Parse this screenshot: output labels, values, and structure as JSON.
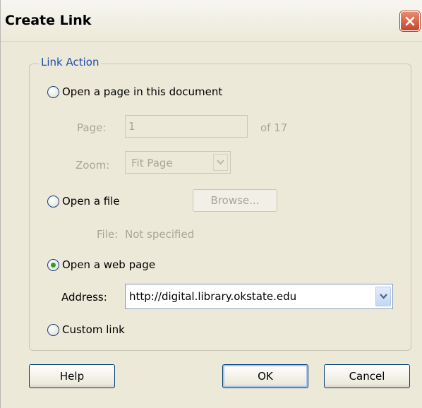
{
  "dialog": {
    "title": "Create Link",
    "close_icon": "close-icon"
  },
  "link_action": {
    "legend": "Link Action",
    "options": {
      "page_in_document": {
        "label": "Open a page in this document",
        "selected": false
      },
      "file": {
        "label": "Open a file",
        "selected": false
      },
      "web_page": {
        "label": "Open a web page",
        "selected": true
      },
      "custom": {
        "label": "Custom link",
        "selected": false
      }
    },
    "page": {
      "label": "Page:",
      "value": "1",
      "of_text": "of 17"
    },
    "zoom": {
      "label": "Zoom:",
      "value": "Fit Page"
    },
    "browse_label": "Browse...",
    "file": {
      "label": "File:",
      "value": "Not specified"
    },
    "address": {
      "label": "Address:",
      "value": "http://digital.library.okstate.edu"
    }
  },
  "buttons": {
    "help": "Help",
    "ok": "OK",
    "cancel": "Cancel"
  },
  "colors": {
    "dialog_bg": "#ece9d8",
    "legend_text": "#1c4ea8",
    "disabled_text": "#a8a695",
    "close_button": "#c6452a",
    "radio_dot": "#2f9a2a"
  }
}
